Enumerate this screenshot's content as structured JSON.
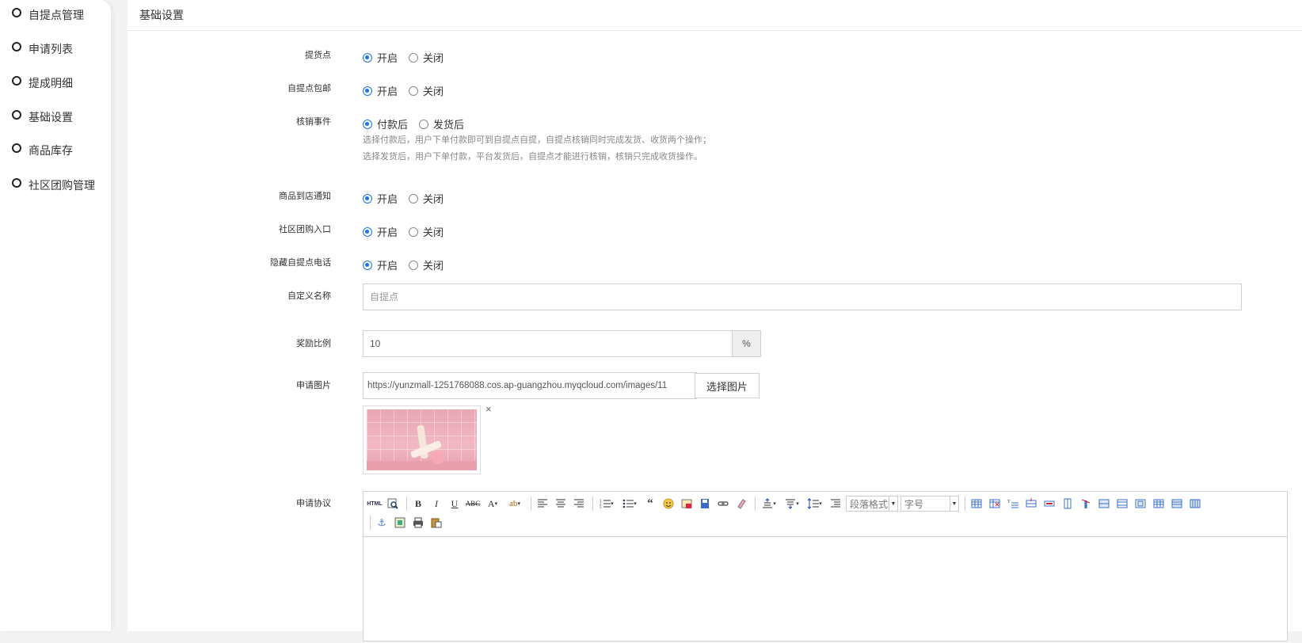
{
  "sidebar": {
    "items": [
      {
        "label": "自提点管理"
      },
      {
        "label": "申请列表"
      },
      {
        "label": "提成明细"
      },
      {
        "label": "基础设置"
      },
      {
        "label": "商品库存"
      },
      {
        "label": "社区团购管理"
      }
    ]
  },
  "main": {
    "title": "基础设置"
  },
  "form": {
    "pickup_point": {
      "label": "提货点",
      "options": [
        "开启",
        "关闭"
      ],
      "selected": "开启"
    },
    "free_shipping": {
      "label": "自提点包邮",
      "options": [
        "开启",
        "关闭"
      ],
      "selected": "开启"
    },
    "verify_event": {
      "label": "核销事件",
      "options": [
        "付款后",
        "发货后"
      ],
      "selected": "付款后",
      "help_1": "选择付款后，用户下单付款即可到自提点自提，自提点核销同时完成发货、收货两个操作；",
      "help_2": "选择发货后，用户下单付款，平台发货后，自提点才能进行核销，核销只完成收货操作。"
    },
    "arrival_notice": {
      "label": "商品到店通知",
      "options": [
        "开启",
        "关闭"
      ],
      "selected": "开启"
    },
    "group_entry": {
      "label": "社区团购入口",
      "options": [
        "开启",
        "关闭"
      ],
      "selected": "开启"
    },
    "hide_phone": {
      "label": "隐藏自提点电话",
      "options": [
        "开启",
        "关闭"
      ],
      "selected": "开启"
    },
    "custom_name": {
      "label": "自定义名称",
      "placeholder": "自提点",
      "value": ""
    },
    "reward_ratio": {
      "label": "奖励比例",
      "value": "10",
      "suffix": "%"
    },
    "apply_image": {
      "label": "申请图片",
      "url": "https://yunzmall-1251768088.cos.ap-guangzhou.myqcloud.com/images/11",
      "button": "选择图片",
      "remove": "×"
    },
    "agreement": {
      "label": "申请协议",
      "toolbar": {
        "paragraph_select": "段落格式",
        "fontsize_select": "字号",
        "html_btn": "HTML"
      }
    }
  }
}
